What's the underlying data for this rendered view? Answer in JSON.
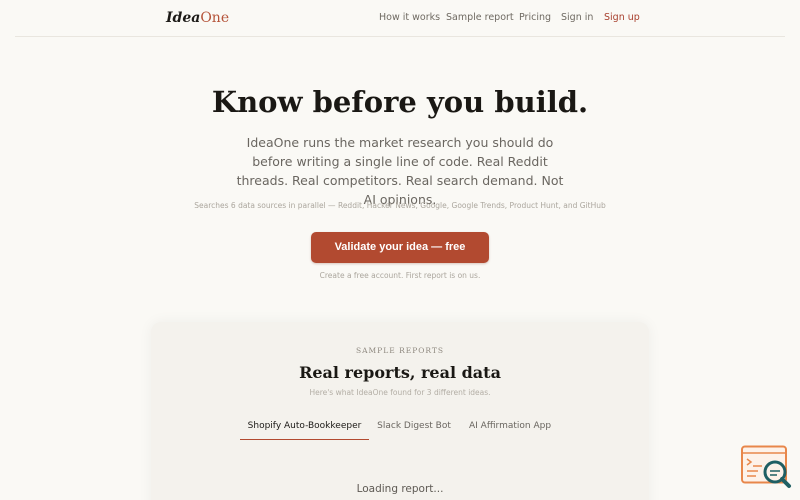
{
  "brand": {
    "part1": "Idea",
    "part2": "One"
  },
  "nav": {
    "how_it_works": "How it works",
    "sample_report": "Sample report",
    "pricing": "Pricing",
    "sign_in": "Sign in",
    "sign_up": "Sign up"
  },
  "hero": {
    "title": "Know before you build.",
    "subtitle": "IdeaOne runs the market research you should do before writing a single line of code. Real Reddit threads. Real competitors. Real search demand. Not AI opinions.",
    "sources": "Searches 6 data sources in parallel — Reddit, Hacker News, Google, Google Trends, Product Hunt, and GitHub",
    "cta_label": "Validate your idea — free",
    "cta_note": "Create a free account. First report is on us."
  },
  "samples": {
    "eyebrow": "SAMPLE REPORTS",
    "title": "Real reports, real data",
    "description": "Here's what IdeaOne found for 3 different ideas.",
    "tabs": [
      {
        "label": "Shopify Auto-Bookkeeper",
        "active": true
      },
      {
        "label": "Slack Digest Bot",
        "active": false
      },
      {
        "label": "AI Affirmation App",
        "active": false
      }
    ],
    "loading_text": "Loading report..."
  },
  "colors": {
    "background": "#faf9f5",
    "accent": "#b24a30",
    "signup_link": "#a8402e",
    "widget_orange": "#e8874a",
    "widget_teal": "#1f5f63"
  },
  "icons": {
    "floating_widget": "search-report-icon"
  }
}
